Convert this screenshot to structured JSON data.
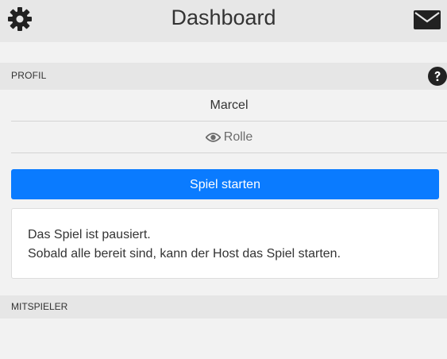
{
  "header": {
    "title": "Dashboard",
    "left_icon": "gear-icon",
    "right_icon": "envelope-icon"
  },
  "profile": {
    "section_label": "PROFIL",
    "help_icon": "question-circle-icon",
    "name": "Marcel",
    "role_label": "Rolle",
    "role_icon": "eye-icon"
  },
  "actions": {
    "start_button_label": "Spiel starten"
  },
  "notice": {
    "line1": "Das Spiel ist pausiert.",
    "line2": "Sobald alle bereit sind, kann der Host das Spiel starten."
  },
  "players": {
    "section_label": "MITSPIELER"
  },
  "colors": {
    "primary": "#0a7bff",
    "header_bg": "#e7e7e7",
    "page_bg": "#f2f2f2"
  }
}
